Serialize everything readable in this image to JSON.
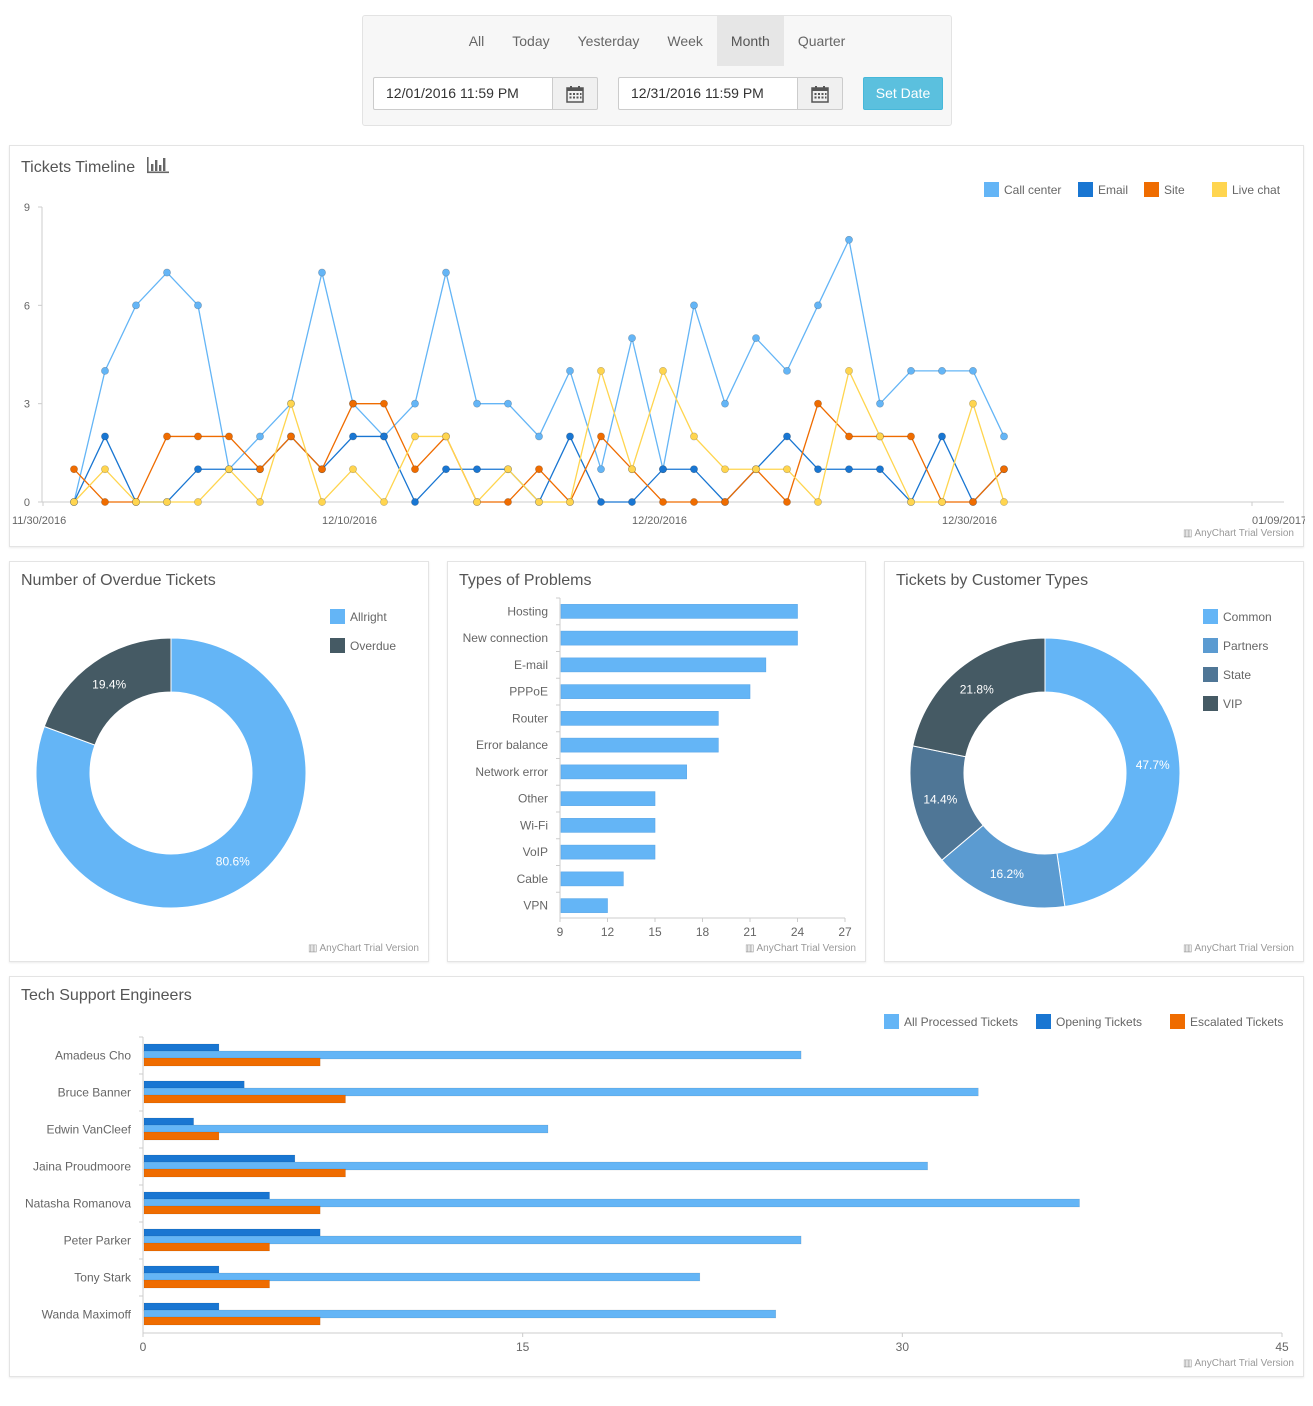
{
  "filter": {
    "tabs": [
      "All",
      "Today",
      "Yesterday",
      "Week",
      "Month",
      "Quarter"
    ],
    "active_tab": "Month",
    "start_date": "12/01/2016 11:59 PM",
    "end_date": "12/31/2016 11:59 PM",
    "set_label": "Set Date"
  },
  "credit": "AnyChart Trial Version",
  "timeline": {
    "title": "Tickets Timeline",
    "icon": "bar-chart-icon",
    "chart_data": {
      "type": "line",
      "x": [
        "11/30/2016",
        "12/01/2016",
        "12/02/2016",
        "12/03/2016",
        "12/04/2016",
        "12/05/2016",
        "12/06/2016",
        "12/07/2016",
        "12/08/2016",
        "12/09/2016",
        "12/10/2016",
        "12/11/2016",
        "12/12/2016",
        "12/13/2016",
        "12/14/2016",
        "12/15/2016",
        "12/16/2016",
        "12/17/2016",
        "12/18/2016",
        "12/19/2016",
        "12/20/2016",
        "12/21/2016",
        "12/22/2016",
        "12/23/2016",
        "12/24/2016",
        "12/25/2016",
        "12/26/2016",
        "12/27/2016",
        "12/28/2016",
        "12/29/2016",
        "12/30/2016",
        "12/31/2016"
      ],
      "x_ticks": [
        "11/30/2016",
        "12/10/2016",
        "12/20/2016",
        "12/30/2016",
        "01/09/2017"
      ],
      "ylim": [
        0,
        9
      ],
      "y_ticks": [
        0,
        3,
        6,
        9
      ],
      "legend_position": "top-right",
      "series": [
        {
          "name": "Call center",
          "color": "#64b5f6",
          "values": [
            0,
            4,
            6,
            7,
            6,
            1,
            2,
            3,
            7,
            3,
            2,
            3,
            7,
            3,
            3,
            2,
            4,
            1,
            5,
            1,
            6,
            3,
            5,
            4,
            6,
            8,
            3,
            4,
            4,
            4,
            2
          ]
        },
        {
          "name": "Email",
          "color": "#1976d2",
          "values": [
            0,
            2,
            0,
            0,
            1,
            1,
            1,
            2,
            1,
            2,
            2,
            0,
            1,
            1,
            1,
            0,
            2,
            0,
            0,
            1,
            1,
            0,
            1,
            2,
            1,
            1,
            1,
            0,
            2,
            0,
            1
          ]
        },
        {
          "name": "Site",
          "color": "#ef6c00",
          "values": [
            1,
            0,
            0,
            2,
            2,
            2,
            1,
            2,
            1,
            3,
            3,
            1,
            2,
            0,
            0,
            1,
            0,
            2,
            1,
            0,
            0,
            0,
            1,
            0,
            3,
            2,
            2,
            2,
            0,
            0,
            1
          ]
        },
        {
          "name": "Live chat",
          "color": "#ffd54f",
          "values": [
            0,
            1,
            0,
            0,
            0,
            1,
            0,
            3,
            0,
            1,
            0,
            2,
            2,
            0,
            1,
            0,
            0,
            4,
            1,
            4,
            2,
            1,
            1,
            1,
            0,
            4,
            2,
            0,
            0,
            3,
            0
          ]
        }
      ]
    }
  },
  "overdue": {
    "title": "Number of Overdue Tickets",
    "chart_data": {
      "type": "pie",
      "legend_position": "top-right",
      "slices": [
        {
          "name": "Allright",
          "value": 80.6,
          "label": "80.6%",
          "color": "#64b5f6"
        },
        {
          "name": "Overdue",
          "value": 19.4,
          "label": "19.4%",
          "color": "#455a64"
        }
      ]
    }
  },
  "problems": {
    "title": "Types of Problems",
    "chart_data": {
      "type": "bar",
      "categories": [
        "Hosting",
        "New connection",
        "E-mail",
        "PPPoE",
        "Router",
        "Error balance",
        "Network error",
        "Other",
        "Wi-Fi",
        "VoIP",
        "Cable",
        "VPN"
      ],
      "values": [
        24,
        24,
        22,
        21,
        19,
        19,
        17,
        15,
        15,
        15,
        13,
        12
      ],
      "xlim": [
        9,
        27
      ],
      "x_ticks": [
        9,
        12,
        15,
        18,
        21,
        24,
        27
      ],
      "color": "#64b5f6"
    }
  },
  "customers": {
    "title": "Tickets by Customer Types",
    "chart_data": {
      "type": "pie",
      "legend_position": "top-right",
      "slices": [
        {
          "name": "Common",
          "value": 47.7,
          "label": "47.7%",
          "color": "#64b5f6"
        },
        {
          "name": "Partners",
          "value": 16.2,
          "label": "16.2%",
          "color": "#5b9bd1"
        },
        {
          "name": "State",
          "value": 14.4,
          "label": "14.4%",
          "color": "#4f7696"
        },
        {
          "name": "VIP",
          "value": 21.8,
          "label": "21.8%",
          "color": "#455a64"
        }
      ]
    }
  },
  "engineers": {
    "title": "Tech Support Engineers",
    "chart_data": {
      "type": "bar",
      "categories": [
        "Amadeus Cho",
        "Bruce Banner",
        "Edwin VanCleef",
        "Jaina Proudmoore",
        "Natasha Romanova",
        "Peter Parker",
        "Tony Stark",
        "Wanda Maximoff"
      ],
      "xlim": [
        0,
        45
      ],
      "x_ticks": [
        0,
        15,
        30,
        45
      ],
      "legend_position": "top-right",
      "series": [
        {
          "name": "All Processed Tickets",
          "color": "#64b5f6",
          "values": [
            26,
            33,
            16,
            31,
            37,
            26,
            22,
            25
          ]
        },
        {
          "name": "Opening Tickets",
          "color": "#1976d2",
          "values": [
            3,
            4,
            2,
            6,
            5,
            7,
            3,
            3
          ]
        },
        {
          "name": "Escalated Tickets",
          "color": "#ef6c00",
          "values": [
            7,
            8,
            3,
            8,
            7,
            5,
            5,
            7
          ]
        }
      ]
    }
  }
}
